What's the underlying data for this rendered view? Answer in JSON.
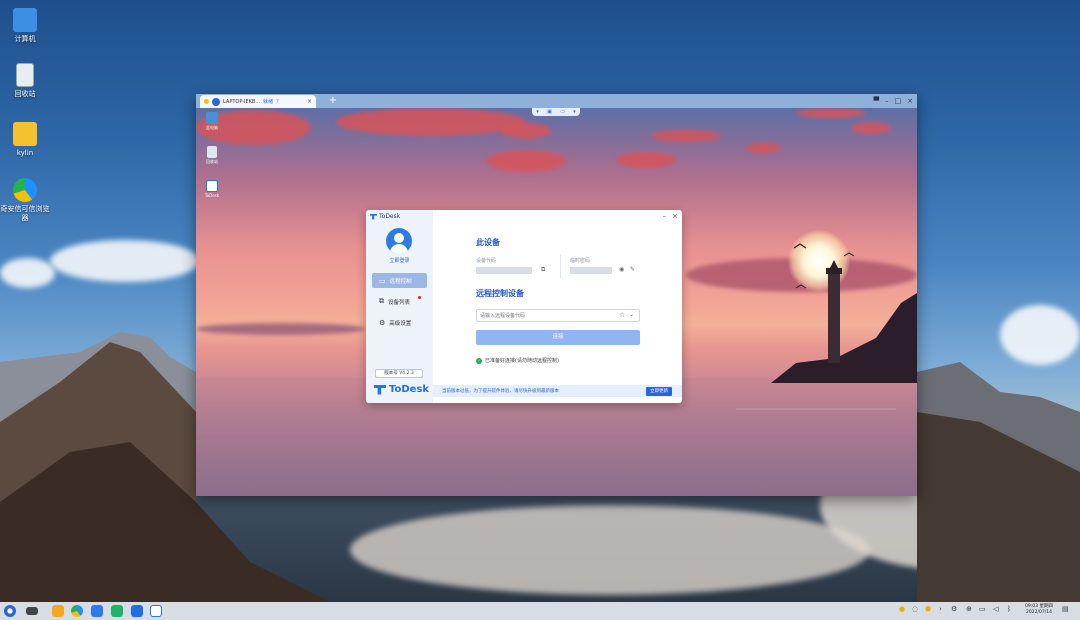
{
  "desktop": {
    "icons": [
      {
        "label": "计算机"
      },
      {
        "label": "回收站"
      },
      {
        "label": "kylin"
      },
      {
        "label": "奇安信可信浏览器"
      }
    ]
  },
  "remote_window": {
    "tab_title": "LAPTOP-IEKB...",
    "tab_status": "就绪",
    "tab_help": "?",
    "tab_close": "×",
    "add_tab": "+",
    "controls": {
      "pin": "▀",
      "minimize": "–",
      "maximize": "□",
      "close": "×"
    },
    "remote_desktop_icons": [
      {
        "label": "此电脑"
      },
      {
        "label": "回收站"
      },
      {
        "label": "ToDesk"
      }
    ]
  },
  "todesk": {
    "app_name": "ToDesk",
    "login_label": "立即登录",
    "nav": [
      {
        "label": "远程控制",
        "icon": "▭"
      },
      {
        "label": "设备列表",
        "icon": "⧉"
      },
      {
        "label": "高级设置",
        "icon": "⚙"
      }
    ],
    "version": "版本号 V4.2.3",
    "brand": "ToDesk",
    "window_controls": {
      "minimize": "–",
      "close": "×"
    },
    "this_device_title": "此设备",
    "device_code_label": "设备代码",
    "temp_password_label": "临时密码",
    "remote_title": "远程控制设备",
    "code_input_placeholder": "请输入远程设备代码",
    "connect_label": "连接",
    "status_text": "已准备好连接(请勿随动远程控制)",
    "update_message": "当前版本过低，为了提升软件体验，请尽快升级到最新版本",
    "update_button": "立即更新"
  },
  "taskbar": {
    "clock_time": "09:03 星期四",
    "clock_date": "2022/07/14"
  }
}
